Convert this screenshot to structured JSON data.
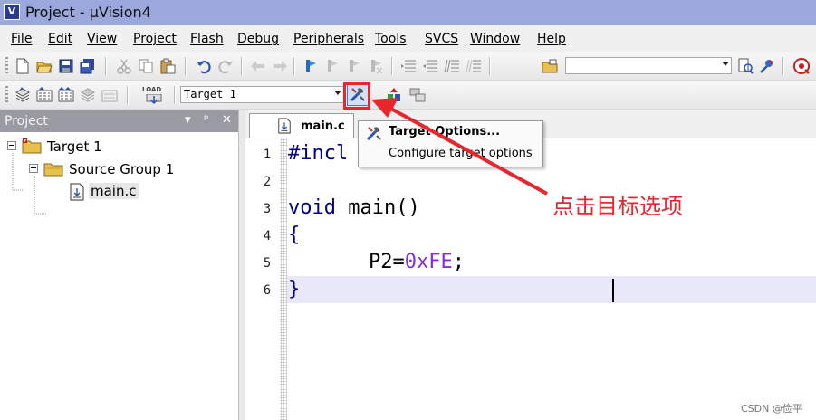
{
  "window": {
    "title": "Project - µVision4",
    "app_icon": "uvision-app-icon"
  },
  "menu": {
    "items": [
      "File",
      "Edit",
      "View",
      "Project",
      "Flash",
      "Debug",
      "Peripherals",
      "Tools",
      "SVCS",
      "Window",
      "Help"
    ]
  },
  "toolbar1": {
    "icons": [
      "new-file-icon",
      "open-folder-icon",
      "save-icon",
      "save-all-icon",
      "cut-icon",
      "copy-icon",
      "paste-icon",
      "undo-icon",
      "redo-icon",
      "nav-back-icon",
      "nav-forward-icon",
      "bookmark-icon",
      "bookmark-prev-icon",
      "bookmark-next-icon",
      "bookmark-clear-icon",
      "indent-icon",
      "unindent-icon",
      "comment-icon",
      "uncomment-icon",
      "find-in-files-icon",
      "find-icon",
      "incremental-find-icon",
      "debug-icon"
    ],
    "find_combo_value": ""
  },
  "toolbar2": {
    "icons": [
      "translate-icon",
      "build-icon",
      "rebuild-icon",
      "batch-build-icon",
      "stop-build-icon",
      "load-icon"
    ],
    "load_text": "LOAD",
    "target_combo_value": "Target 1",
    "target_options_icon": "target-options-icon",
    "manage_components_icon": "manage-components-icon",
    "extensions_icon": "multi-project-icon"
  },
  "project_panel": {
    "title": "Project",
    "controls": [
      "▾",
      "ᵖ",
      "✕"
    ],
    "tree": [
      {
        "label": "Target 1",
        "level": 0
      },
      {
        "label": "Source Group 1",
        "level": 1
      },
      {
        "label": "main.c",
        "level": 2
      }
    ]
  },
  "editor": {
    "tab_label": "main.c",
    "lines": [
      {
        "num": "1",
        "text": "#incl"
      },
      {
        "num": "2",
        "text": ""
      },
      {
        "num": "3",
        "text": "void main()"
      },
      {
        "num": "4",
        "text": "{"
      },
      {
        "num": "5",
        "text": "P2=0xFE;"
      },
      {
        "num": "6",
        "text": "}"
      }
    ]
  },
  "popup": {
    "title": "Target Options...",
    "subtitle": "Configure target options"
  },
  "annotation": "点击目标选项",
  "watermark": "CSDN @俭平",
  "colors": {
    "title_bar": "#9aa8de",
    "accent_red": "#e8262d",
    "keyword_blue": "#00008b",
    "hex_purple": "#8a2be2",
    "current_line": "#e8e8f8"
  }
}
